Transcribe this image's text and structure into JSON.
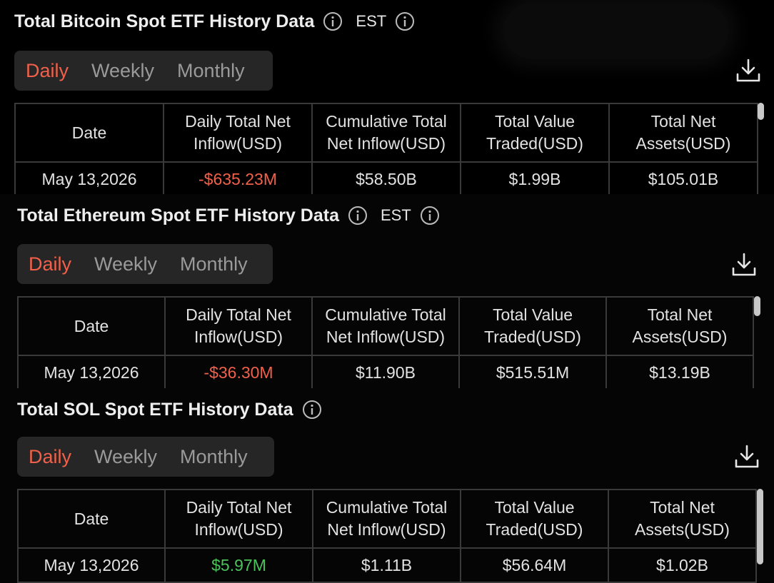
{
  "tabs": [
    "Daily",
    "Weekly",
    "Monthly"
  ],
  "columns": [
    "Date",
    "Daily Total Net Inflow(USD)",
    "Cumulative Total Net Inflow(USD)",
    "Total Value Traded(USD)",
    "Total Net Assets(USD)"
  ],
  "colors": {
    "negative": "#f0604a",
    "positive": "#4cc25a",
    "active_tab": "#f0604a"
  },
  "icons": {
    "info": "info-icon",
    "download": "download-icon"
  },
  "sections": [
    {
      "title": "Total Bitcoin Spot ETF History Data",
      "timezone": "EST",
      "row": {
        "date": "May 13,2026",
        "daily_net_inflow": "-$635.23M",
        "cumulative_net_inflow": "$58.50B",
        "total_value_traded": "$1.99B",
        "total_net_assets": "$105.01B"
      }
    },
    {
      "title": "Total Ethereum Spot ETF History Data",
      "timezone": "EST",
      "row": {
        "date": "May 13,2026",
        "daily_net_inflow": "-$36.30M",
        "cumulative_net_inflow": "$11.90B",
        "total_value_traded": "$515.51M",
        "total_net_assets": "$13.19B"
      }
    },
    {
      "title": "Total SOL Spot ETF History Data",
      "row": {
        "date": "May 13,2026",
        "daily_net_inflow": "$5.97M",
        "cumulative_net_inflow": "$1.11B",
        "total_value_traded": "$56.64M",
        "total_net_assets": "$1.02B"
      }
    }
  ]
}
